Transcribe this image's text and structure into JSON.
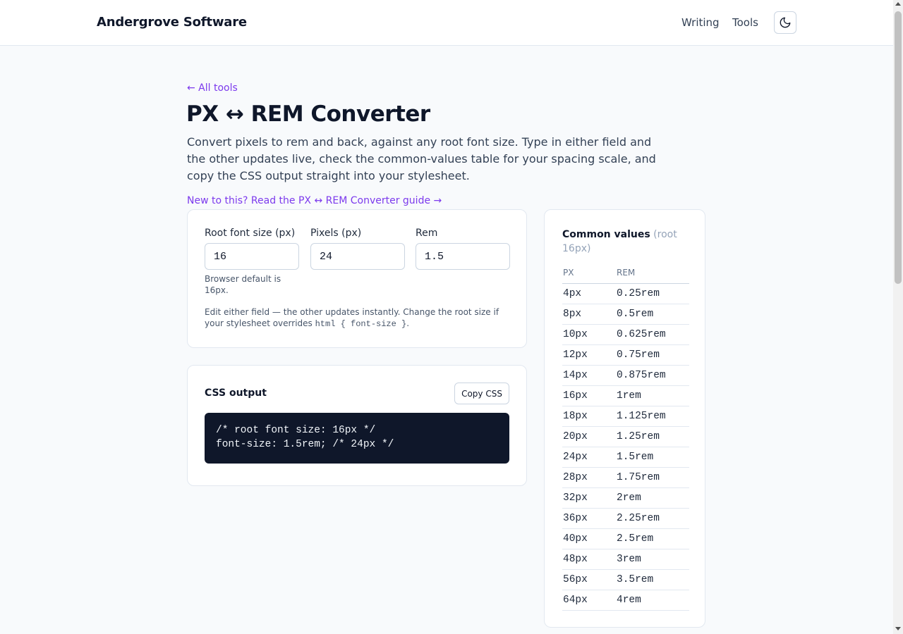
{
  "header": {
    "brand": "Andergrove Software",
    "nav": [
      {
        "label": "Writing"
      },
      {
        "label": "Tools"
      }
    ],
    "theme_icon": "moon-icon"
  },
  "page": {
    "back_link": "← All tools",
    "title": "PX ↔ REM Converter",
    "lead": "Convert pixels to rem and back, against any root font size. Type in either field and the other updates live, check the common-values table for your spacing scale, and copy the CSS output straight into your stylesheet.",
    "guide_link": "New to this? Read the PX ↔ REM Converter guide →"
  },
  "converter": {
    "fields": [
      {
        "label": "Root font size (px)",
        "value": "16"
      },
      {
        "label": "Pixels (px)",
        "value": "24"
      },
      {
        "label": "Rem",
        "value": "1.5"
      }
    ],
    "root_hint": "Browser default is 16px.",
    "note_text": "Edit either field — the other updates instantly. Change the root size if your stylesheet overrides ",
    "note_code": "html { font-size }",
    "note_end": "."
  },
  "css_output": {
    "title": "CSS output",
    "copy_label": "Copy CSS",
    "code": "/* root font size: 16px */\nfont-size: 1.5rem; /* 24px */"
  },
  "common_values": {
    "title": "Common values",
    "subtitle": "(root 16px)",
    "col_px": "PX",
    "col_rem": "REM",
    "rows": [
      {
        "px": "4px",
        "rem": "0.25rem"
      },
      {
        "px": "8px",
        "rem": "0.5rem"
      },
      {
        "px": "10px",
        "rem": "0.625rem"
      },
      {
        "px": "12px",
        "rem": "0.75rem"
      },
      {
        "px": "14px",
        "rem": "0.875rem"
      },
      {
        "px": "16px",
        "rem": "1rem"
      },
      {
        "px": "18px",
        "rem": "1.125rem"
      },
      {
        "px": "20px",
        "rem": "1.25rem"
      },
      {
        "px": "24px",
        "rem": "1.5rem"
      },
      {
        "px": "28px",
        "rem": "1.75rem"
      },
      {
        "px": "32px",
        "rem": "2rem"
      },
      {
        "px": "36px",
        "rem": "2.25rem"
      },
      {
        "px": "40px",
        "rem": "2.5rem"
      },
      {
        "px": "48px",
        "rem": "3rem"
      },
      {
        "px": "56px",
        "rem": "3.5rem"
      },
      {
        "px": "64px",
        "rem": "4rem"
      }
    ]
  },
  "colors": {
    "accent": "#7c3aed",
    "text": "#0f172a",
    "code_bg": "#0f172a",
    "page_bg": "#f8fafc"
  }
}
